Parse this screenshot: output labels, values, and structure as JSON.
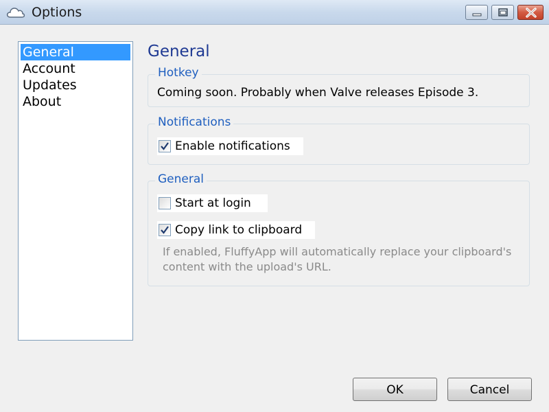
{
  "window": {
    "title": "Options",
    "icon": "cloud-icon",
    "controls": {
      "minimize": "minimize-icon",
      "maximize": "maximize-icon",
      "close": "close-icon"
    }
  },
  "sidebar": {
    "items": [
      {
        "label": "General",
        "selected": true
      },
      {
        "label": "Account",
        "selected": false
      },
      {
        "label": "Updates",
        "selected": false
      },
      {
        "label": "About",
        "selected": false
      }
    ]
  },
  "main": {
    "heading": "General",
    "groups": {
      "hotkey": {
        "title": "Hotkey",
        "text": "Coming soon. Probably when Valve releases Episode 3."
      },
      "notifications": {
        "title": "Notifications",
        "enable_notifications": {
          "label": "Enable notifications",
          "checked": true
        }
      },
      "general": {
        "title": "General",
        "start_at_login": {
          "label": "Start at login",
          "checked": false
        },
        "copy_link": {
          "label": "Copy link to clipboard",
          "checked": true
        },
        "help": "If enabled, FluffyApp will automatically replace your clipboard's content with the upload's URL."
      }
    }
  },
  "footer": {
    "ok_label": "OK",
    "cancel_label": "Cancel"
  },
  "colors": {
    "accent": "#3399ff",
    "heading": "#1f3a93",
    "group_title": "#1f5fbf",
    "help_text": "#8a8a8a",
    "close_button": "#d35b43"
  }
}
